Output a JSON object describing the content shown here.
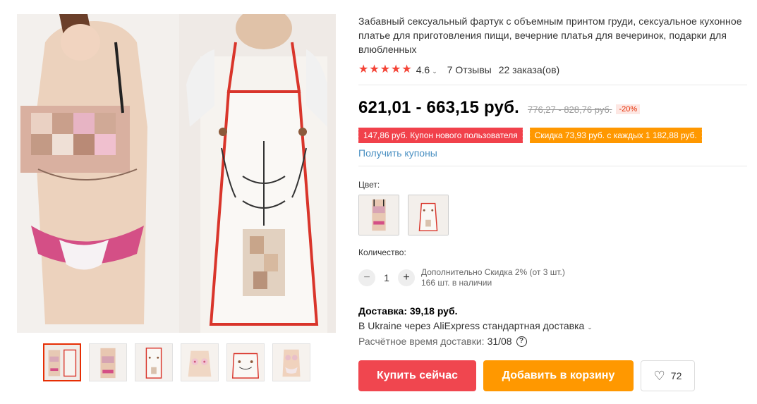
{
  "product": {
    "title": "Забавный сексуальный фартук с объемным принтом груди, сексуальное кухонное платье для приготовления пищи, вечерние платья для вечеринок, подарки для влюбленных",
    "rating": {
      "stars": 5,
      "value": "4.6",
      "reviews": "7 Отзывы",
      "orders": "22 заказа(ов)"
    },
    "price": {
      "current": "621,01 - 663,15 руб.",
      "original": "776,27 - 828,76 руб.",
      "discount": "-20%"
    },
    "coupons": [
      {
        "text": "147,86 руб. Купон нового пользователя",
        "color": "#f1414b"
      },
      {
        "text": "Скидка 73,93 руб. с каждых 1 182,88 руб.",
        "color": "#ff9800"
      }
    ],
    "get_coupons_label": "Получить купоны",
    "color_label": "Цвет:",
    "swatches": [
      "female-apron",
      "male-apron"
    ],
    "quantity": {
      "label": "Количество:",
      "value": "1",
      "minus": "−",
      "plus": "+",
      "note_line1": "Дополнительно Скидка 2% (от 3 шт.)",
      "note_line2": "166 шт. в наличии"
    },
    "delivery": {
      "title": "Доставка: 39,18 руб.",
      "method": "В Ukraine через AliExpress стандартная доставка",
      "eta_label": "Расчётное время доставки:",
      "eta_date": "31/08"
    },
    "actions": {
      "buy": "Купить сейчас",
      "cart": "Добавить в корзину",
      "wishlist_count": "72"
    },
    "gallery": {
      "thumbnails": 6,
      "active_index": 0
    }
  },
  "colors": {
    "accent_red": "#f0464f",
    "accent_orange": "#ff9800",
    "link_blue": "#4a90c2"
  },
  "icons": {
    "star": "★",
    "chevron": "⌄",
    "help": "?",
    "heart": "♡"
  }
}
